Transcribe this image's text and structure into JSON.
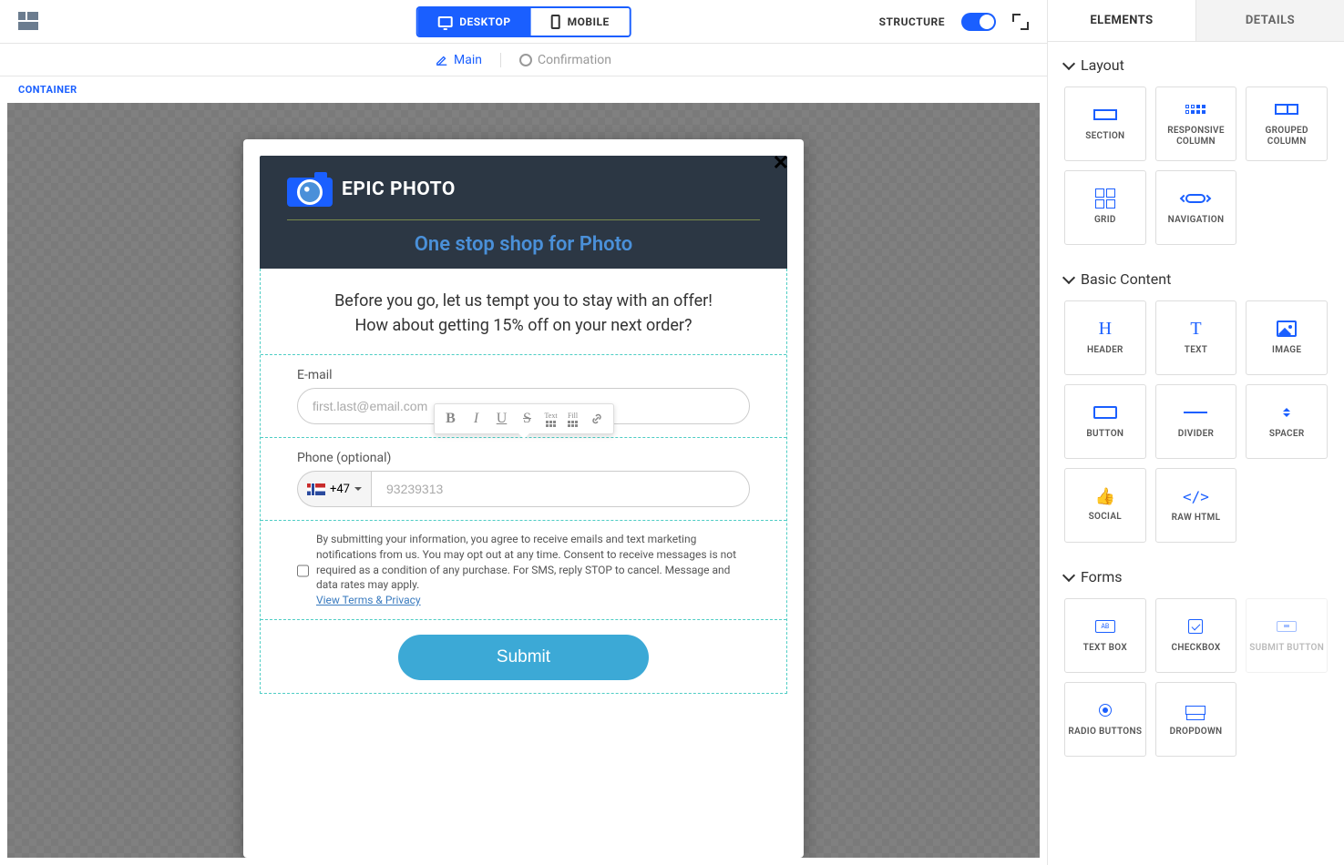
{
  "topbar": {
    "desktop": "DESKTOP",
    "mobile": "MOBILE",
    "structure": "STRUCTURE"
  },
  "subbar": {
    "main": "Main",
    "confirmation": "Confirmation"
  },
  "container_label": "CONTAINER",
  "popup": {
    "brand": "EPIC PHOTO",
    "tagline": "One stop shop for Photo",
    "offer_line1": "Before you go, let us tempt you to stay with an offer!",
    "offer_line2": "How about getting 15% off on your next order?",
    "email_label": "E-mail",
    "email_placeholder": "first.last@email.com",
    "phone_label": "Phone (optional)",
    "country_code": "+47",
    "phone_placeholder": "93239313",
    "consent": "By submitting your information, you agree to receive emails and text marketing notifications from us. You may opt out at any time. Consent to receive messages is not required as a condition of any purchase. For SMS, reply STOP to cancel. Message and data rates may apply.",
    "consent_link": "View Terms & Privacy",
    "submit": "Submit"
  },
  "toolbar": {
    "text": "Text",
    "fill": "Fill"
  },
  "tabs": {
    "elements": "ELEMENTS",
    "details": "DETAILS"
  },
  "sections": {
    "layout": "Layout",
    "basic": "Basic Content",
    "forms": "Forms"
  },
  "elements": {
    "section": "SECTION",
    "responsive_column": "RESPONSIVE COLUMN",
    "grouped_column": "GROUPED COLUMN",
    "grid": "GRID",
    "navigation": "NAVIGATION",
    "header": "HEADER",
    "text": "TEXT",
    "image": "IMAGE",
    "button": "BUTTON",
    "divider": "DIVIDER",
    "spacer": "SPACER",
    "social": "SOCIAL",
    "rawhtml": "RAW HTML",
    "textbox": "TEXT BOX",
    "checkbox": "CHECKBOX",
    "submit_button": "SUBMIT BUTTON",
    "radio_buttons": "RADIO BUTTONS",
    "dropdown": "DROPDOWN"
  }
}
